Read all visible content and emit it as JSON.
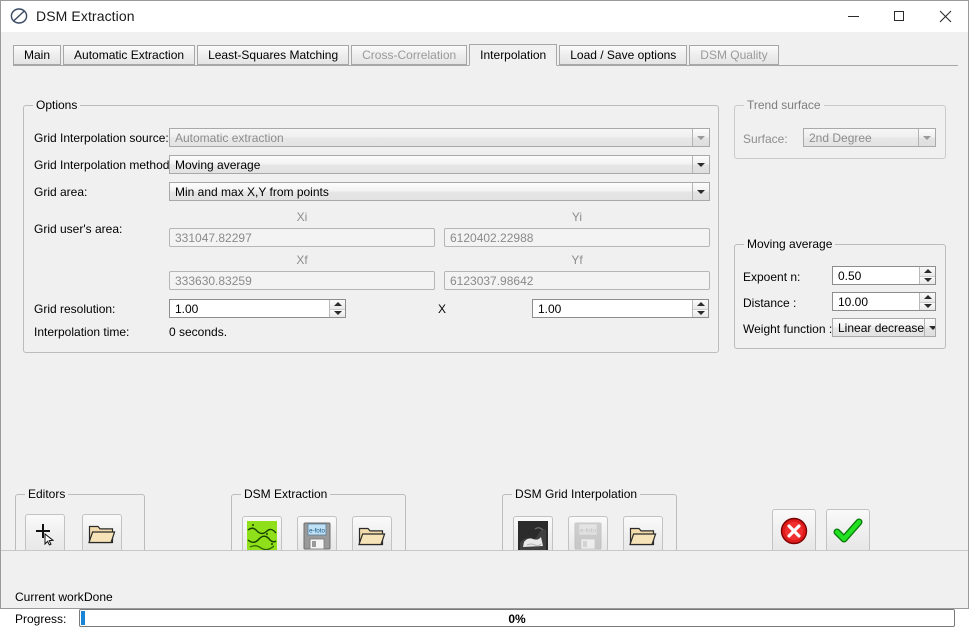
{
  "window": {
    "title": "DSM Extraction",
    "icon": "slashed-circle-icon",
    "minimize_label": "Minimize",
    "maximize_label": "Maximize",
    "close_label": "Close"
  },
  "tabs": [
    {
      "label": "Main",
      "state": "normal"
    },
    {
      "label": "Automatic Extraction",
      "state": "normal"
    },
    {
      "label": "Least-Squares Matching",
      "state": "normal"
    },
    {
      "label": "Cross-Correlation",
      "state": "disabled"
    },
    {
      "label": "Interpolation",
      "state": "active"
    },
    {
      "label": "Load / Save options",
      "state": "normal"
    },
    {
      "label": "DSM Quality",
      "state": "disabled"
    }
  ],
  "options": {
    "title": "Options",
    "grid_interpolation_source": {
      "label": "Grid Interpolation source:",
      "value": "Automatic extraction",
      "enabled": false
    },
    "grid_interpolation_method": {
      "label": "Grid Interpolation method:",
      "value": "Moving average",
      "enabled": true
    },
    "grid_area": {
      "label": "Grid area:",
      "value": "Min and max X,Y from points",
      "enabled": true
    },
    "grid_users_area": {
      "label": "Grid user's area:",
      "xi_header": "Xi",
      "yi_header": "Yi",
      "xf_header": "Xf",
      "yf_header": "Yf",
      "xi_value": "331047.82297",
      "yi_value": "6120402.22988",
      "xf_value": "333630.83259",
      "yf_value": "6123037.98642"
    },
    "grid_resolution": {
      "label": "Grid resolution:",
      "x_value": "1.00",
      "separator": "X",
      "y_value": "1.00"
    },
    "interpolation_time": {
      "label": "Interpolation time:",
      "value": "0 seconds."
    }
  },
  "trend_surface": {
    "title": "Trend surface",
    "surface": {
      "label": "Surface:",
      "value": "2nd Degree",
      "enabled": false
    }
  },
  "moving_average": {
    "title": "Moving average",
    "exponent": {
      "label": "Expoent n:",
      "value": "0.50"
    },
    "distance": {
      "label": "Distance :",
      "value": "10.00"
    },
    "weight_function": {
      "label": "Weight function :",
      "value": "Linear decrease"
    }
  },
  "editors": {
    "title": "Editors",
    "buttons": [
      {
        "name": "new-editor-button",
        "icon": "plus-cursor-icon"
      },
      {
        "name": "open-editor-button",
        "icon": "folder-open-icon"
      }
    ]
  },
  "dsm_extraction_panel": {
    "title": "DSM Extraction",
    "buttons": [
      {
        "name": "view-dsm-button",
        "icon": "green-terrain-image-icon",
        "enabled": true
      },
      {
        "name": "save-dsm-button",
        "icon": "floppy-disk-icon",
        "enabled": true
      },
      {
        "name": "open-dsm-button",
        "icon": "folder-open-icon",
        "enabled": true
      }
    ]
  },
  "dsm_grid_interpolation_panel": {
    "title": "DSM Grid Interpolation",
    "buttons": [
      {
        "name": "view-grid-button",
        "icon": "gray-terrain-image-icon",
        "enabled": true
      },
      {
        "name": "save-grid-button",
        "icon": "floppy-disk-icon",
        "enabled": false
      },
      {
        "name": "open-grid-button",
        "icon": "folder-open-icon",
        "enabled": true
      }
    ]
  },
  "actions": {
    "cancel": {
      "name": "cancel-button",
      "icon": "red-x-circle-icon"
    },
    "ok": {
      "name": "ok-button",
      "icon": "green-check-icon"
    }
  },
  "statusbar": {
    "current_work_label": "Current work:",
    "current_work_value": "Done",
    "progress_label": "Progress:",
    "progress_percent": "0%",
    "progress_value": 0
  },
  "colors": {
    "accent": "#1a85d6",
    "ok_green": "#22c222",
    "cancel_red": "#e01b1b",
    "terrain_green": "#8fe01a",
    "window_bg": "#f0f0f0"
  }
}
